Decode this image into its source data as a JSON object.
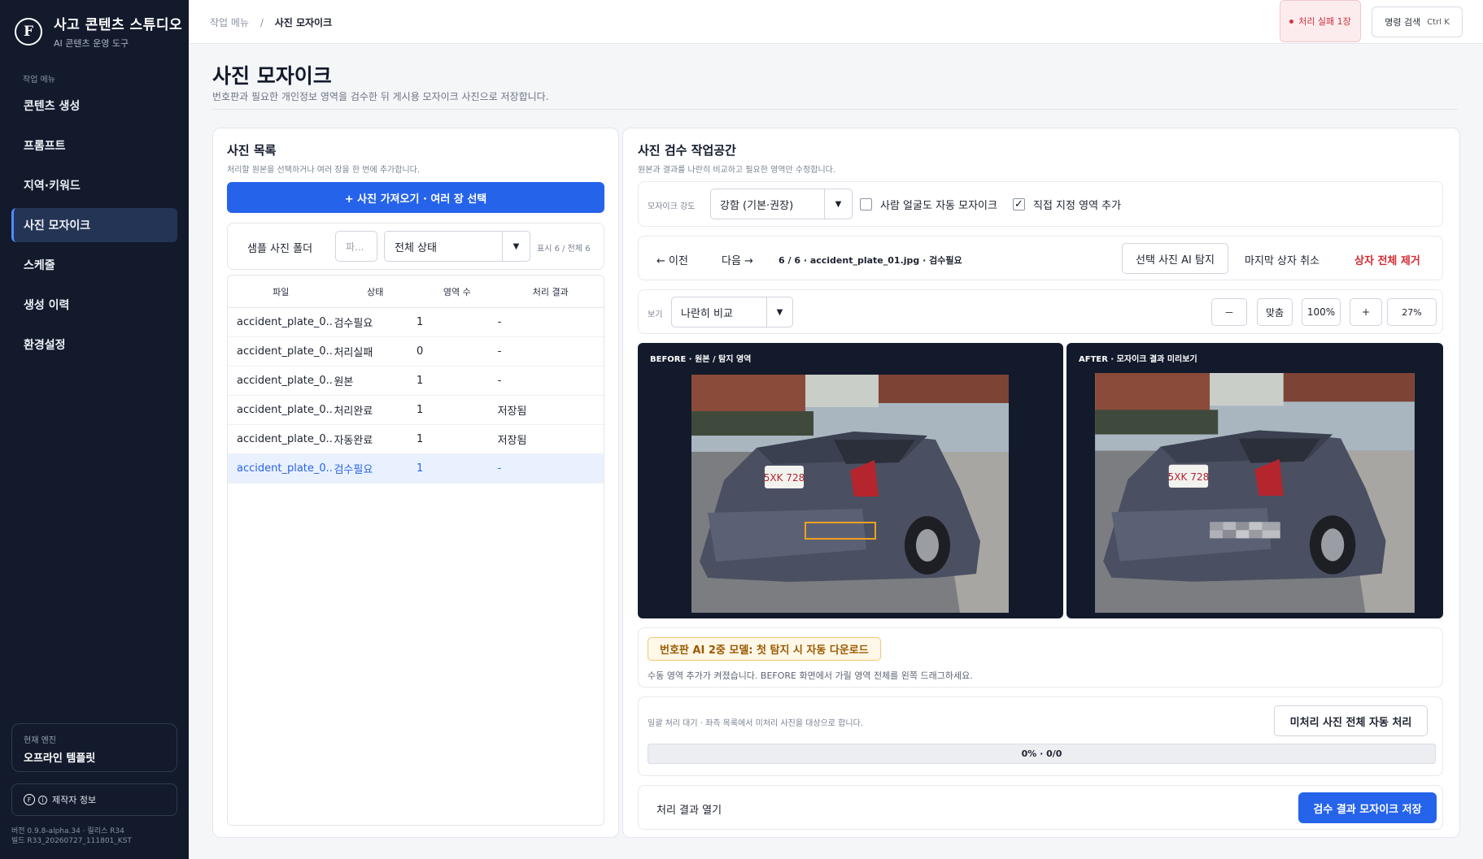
{
  "app": {
    "logo_text": "F",
    "title": "사고 콘텐츠 스튜디오",
    "subtitle": "AI 콘텐츠 운영 도구"
  },
  "sidebar": {
    "section_label": "작업 메뉴",
    "items": [
      {
        "label": "콘텐츠 생성",
        "active": false
      },
      {
        "label": "프롬프트",
        "active": false
      },
      {
        "label": "지역·키워드",
        "active": false
      },
      {
        "label": "사진 모자이크",
        "active": true
      },
      {
        "label": "스케줄",
        "active": false
      },
      {
        "label": "생성 이력",
        "active": false
      },
      {
        "label": "환경설정",
        "active": false
      }
    ],
    "engine_label": "현재 엔진",
    "engine_value": "오프라인 템플릿",
    "maker_label": "제작자 정보",
    "version_line1": "버전 0.9.8-alpha.34 · 릴리스 R34",
    "version_line2": "빌드 R33_20260727_111801_KST"
  },
  "topbar": {
    "breadcrumb_root": "작업 메뉴",
    "breadcrumb_sep": "/",
    "breadcrumb_current": "사진 모자이크",
    "fail_badge": "처리 실패 1장",
    "command_label": "명령 검색",
    "command_shortcut": "Ctrl K"
  },
  "page": {
    "title": "사진 모자이크",
    "description": "번호판과 필요한 개인정보 영역을 검수한 뒤 게시용 모자이크 사진으로 저장합니다."
  },
  "photo_list": {
    "title": "사진 목록",
    "subtitle": "처리할 원본을 선택하거나 여러 장을 한 번에 추가합니다.",
    "import_button": "+ 사진 가져오기 · 여러 장 선택",
    "sample_folder_label": "샘플 사진 폴더",
    "folder_input_placeholder": "파...",
    "status_filter": "전체 상태",
    "count_text": "표시 6 / 전체 6",
    "columns": [
      "파일",
      "상태",
      "영역 수",
      "처리 결과"
    ],
    "rows": [
      {
        "file": "accident_plate_0...",
        "status": "검수필요",
        "areas": "1",
        "result": "-",
        "selected": false
      },
      {
        "file": "accident_plate_0...",
        "status": "처리실패",
        "areas": "0",
        "result": "-",
        "selected": false
      },
      {
        "file": "accident_plate_0...",
        "status": "원본",
        "areas": "1",
        "result": "-",
        "selected": false
      },
      {
        "file": "accident_plate_0...",
        "status": "처리완료",
        "areas": "1",
        "result": "저장됨",
        "selected": false
      },
      {
        "file": "accident_plate_0...",
        "status": "자동완료",
        "areas": "1",
        "result": "저장됨",
        "selected": false
      },
      {
        "file": "accident_plate_0...",
        "status": "검수필요",
        "areas": "1",
        "result": "-",
        "selected": true
      }
    ]
  },
  "workspace": {
    "title": "사진 검수 작업공간",
    "subtitle": "원본과 결과를 나란히 비교하고 필요한 영역만 수정합니다.",
    "strength_label": "모자이크 강도",
    "strength_value": "강함 (기본·권장)",
    "auto_face_label": "사람 얼굴도 자동 모자이크",
    "auto_face_checked": false,
    "manual_area_label": "직접 지정 영역 추가",
    "manual_area_checked": true,
    "prev_label": "← 이전",
    "next_label": "다음 →",
    "file_info": "6 / 6 · accident_plate_01.jpg · 검수필요",
    "ai_detect_button": "선택 사진 AI 탐지",
    "undo_box_button": "마지막 상자 취소",
    "remove_all_button": "상자 전체 제거",
    "view_label": "보기",
    "view_mode": "나란히 비교",
    "zoom_out": "－",
    "fit_label": "맞춤",
    "zoom_100": "100%",
    "zoom_in": "+",
    "zoom_value": "27%",
    "before_title": "BEFORE · 원본 / 탐지 영역",
    "after_title": "AFTER · 모자이크 결과 미리보기",
    "plate_text": "5XK 728",
    "notice_badge": "번호판 AI 2중 모델: 첫 탐지 시 자동 다운로드",
    "notice_text": "수동 영역 추가가 켜졌습니다. BEFORE 화면에서 가릴 영역 전체를 왼쪽 드래그하세요.",
    "batch_text": "일괄 처리 대기 · 좌측 목록에서 미처리 사진을 대상으로 합니다.",
    "batch_button": "미처리 사진 전체 자동 처리",
    "progress_percent": 0,
    "progress_label": "0% · 0/0",
    "open_result": "처리 결과 열기",
    "save_button": "검수 결과 모자이크 저장"
  },
  "colors": {
    "sidebar_bg": "#121a2c",
    "accent": "#2563eb",
    "danger": "#d22a34",
    "warning": "#9a5a00"
  }
}
